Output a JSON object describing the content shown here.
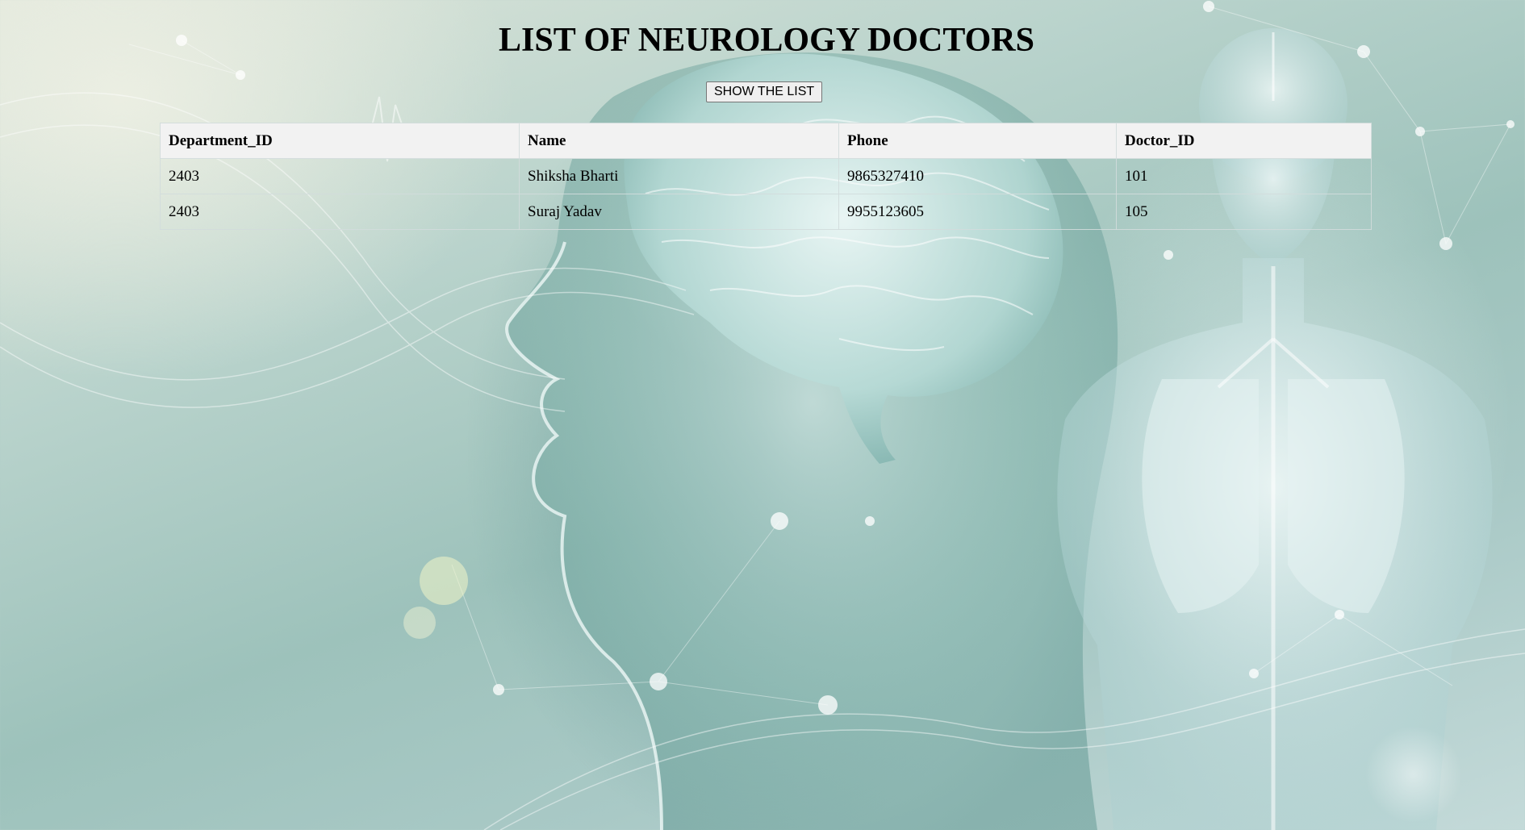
{
  "page": {
    "title": "LIST OF NEUROLOGY DOCTORS",
    "show_button_label": "SHOW THE LIST"
  },
  "table": {
    "headers": [
      "Department_ID",
      "Name",
      "Phone",
      "Doctor_ID"
    ],
    "rows": [
      [
        "2403",
        "Shiksha Bharti",
        "9865327410",
        "101"
      ],
      [
        "2403",
        "Suraj Yadav",
        "9955123605",
        "105"
      ]
    ]
  },
  "colors": {
    "header_bg": "#f2f2f2",
    "text": "#000000",
    "background_tint": "#a9c9c6"
  },
  "background": {
    "icons": [
      "brain-illustration-icon",
      "head-profile-icon",
      "human-torso-lungs-icon",
      "network-nodes-icon"
    ]
  }
}
